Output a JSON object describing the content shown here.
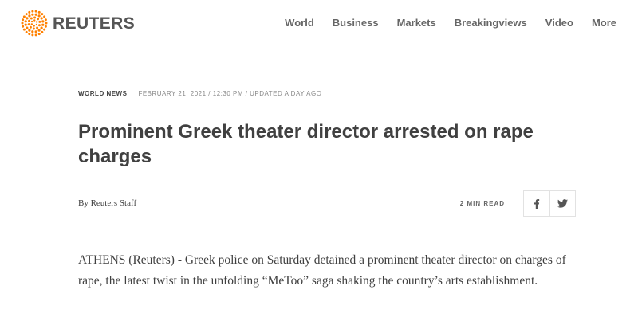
{
  "brand": {
    "name": "REUTERS",
    "accent": "#ff8000"
  },
  "nav": {
    "items": [
      {
        "label": "World"
      },
      {
        "label": "Business"
      },
      {
        "label": "Markets"
      },
      {
        "label": "Breakingviews"
      },
      {
        "label": "Video"
      },
      {
        "label": "More"
      }
    ]
  },
  "article": {
    "section": "WORLD NEWS",
    "dateline": "FEBRUARY 21, 2021 / 12:30 PM / UPDATED A DAY AGO",
    "headline": "Prominent Greek theater director arrested on rape charges",
    "byline": "By Reuters Staff",
    "read_time": "2 MIN READ",
    "body": "ATHENS (Reuters) - Greek police on Saturday detained a prominent theater director on charges of rape, the latest twist in the unfolding “MeToo” saga shaking the country’s arts establishment."
  },
  "share": {
    "facebook_icon": "facebook-icon",
    "twitter_icon": "twitter-icon"
  },
  "colors": {
    "text": "#404040",
    "muted": "#888888",
    "nav": "#666666",
    "border": "#e6e6e6"
  }
}
